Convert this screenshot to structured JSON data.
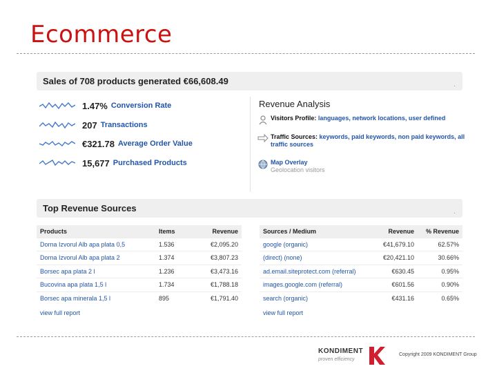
{
  "slide": {
    "title": "Ecommerce"
  },
  "summary": {
    "title": "Sales of 708 products generated €66,608.49"
  },
  "metrics": [
    {
      "value": "1.47%",
      "label": "Conversion Rate"
    },
    {
      "value": "207",
      "label": "Transactions"
    },
    {
      "value": "€321.78",
      "label": "Average Order Value"
    },
    {
      "value": "15,677",
      "label": "Purchased Products"
    }
  ],
  "revenue_analysis": {
    "title": "Revenue Analysis",
    "items": [
      {
        "icon": "user-icon",
        "key": "Visitors Profile:",
        "links": "languages,  network locations,  user defined",
        "sub": ""
      },
      {
        "icon": "traffic-arrow-icon",
        "key": "Traffic Sources:",
        "links": "keywords,  paid keywords,  non paid keywords,  all traffic sources",
        "sub": ""
      },
      {
        "icon": "globe-icon",
        "key": "",
        "links": "Map Overlay",
        "sub": "Geolocation visitors"
      }
    ]
  },
  "top_revenue": {
    "title": "Top Revenue Sources",
    "products": {
      "headers": [
        "Products",
        "Items",
        "Revenue"
      ],
      "rows": [
        [
          "Dorna Izvorul Alb apa plata 0,5",
          "1.536",
          "€2,095.20"
        ],
        [
          "Dorna Izvorul Alb apa plata 2",
          "1.374",
          "€3,807.23"
        ],
        [
          "Borsec apa plata 2 l",
          "1.236",
          "€3,473.16"
        ],
        [
          "Bucovina apa plata 1,5 l",
          "1.734",
          "€1,788.18"
        ],
        [
          "Borsec apa minerala 1,5 l",
          "895",
          "€1,791.40"
        ]
      ],
      "more": "view full report"
    },
    "sources": {
      "headers": [
        "Sources / Medium",
        "Revenue",
        "% Revenue"
      ],
      "rows": [
        [
          "google (organic)",
          "€41,679.10",
          "62.57%"
        ],
        [
          "(direct) (none)",
          "€20,421.10",
          "30.66%"
        ],
        [
          "ad.email.siteprotect.com (referral)",
          "€630.45",
          "0.95%"
        ],
        [
          "images.google.com (referral)",
          "€601.56",
          "0.90%"
        ],
        [
          "search (organic)",
          "€431.16",
          "0.65%"
        ]
      ],
      "more": "view full report"
    }
  },
  "footer": {
    "logo_word": "KONDIMENT",
    "logo_tag": "proven efficiency",
    "copyright": "Copyright 2009 KONDIMENT Group"
  },
  "colors": {
    "title_red": "#cc1111",
    "link_blue": "#2255aa",
    "logo_red": "#d01f2f",
    "bar_gray": "#efefef"
  }
}
